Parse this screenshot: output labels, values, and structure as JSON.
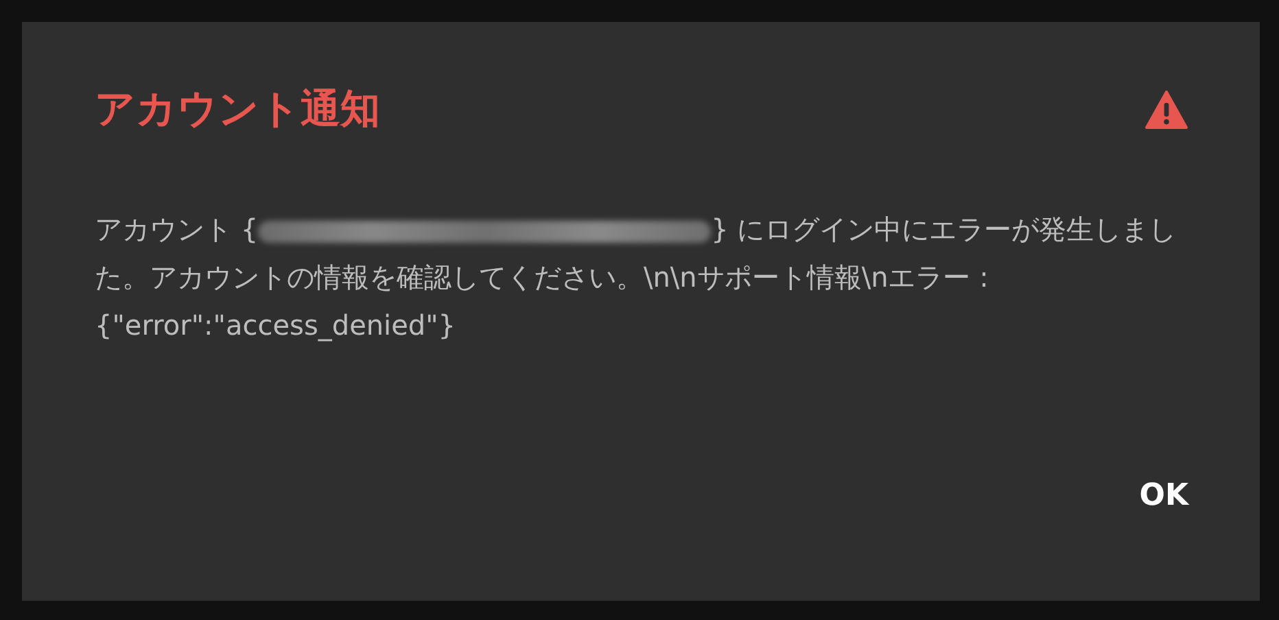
{
  "dialog": {
    "title": "アカウント通知",
    "message": {
      "before": "アカウント {",
      "redacted": true,
      "after": "} にログイン中にエラーが発生しました。アカウントの情報を確認してください。\\n\\nサポート情報\\nエラー :{\"error\":\"access_denied\"}"
    },
    "buttons": [
      "OK"
    ]
  }
}
